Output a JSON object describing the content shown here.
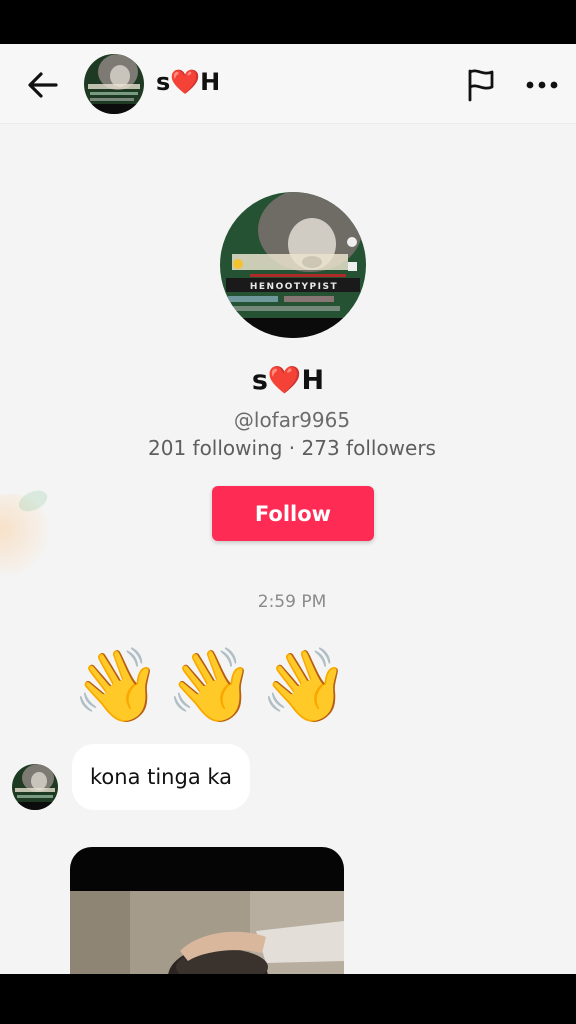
{
  "header": {
    "username": "s❤️H",
    "back_icon": "arrow-left-icon",
    "report_icon": "flag-icon",
    "more_icon": "ellipsis-icon"
  },
  "profile": {
    "name": "s❤️H",
    "handle": "@lofar9965",
    "stats": "201 following · 273 followers",
    "follow_label": "Follow",
    "avatar_overlay_text": "HENOOTYPIST"
  },
  "chat": {
    "timestamp": "2:59 PM",
    "waves": [
      "👋",
      "👋",
      "👋"
    ],
    "message_text": "kona tinga ka"
  },
  "colors": {
    "follow_button": "#fe2c55",
    "background": "#f4f4f4",
    "bubble": "#ffffff"
  }
}
